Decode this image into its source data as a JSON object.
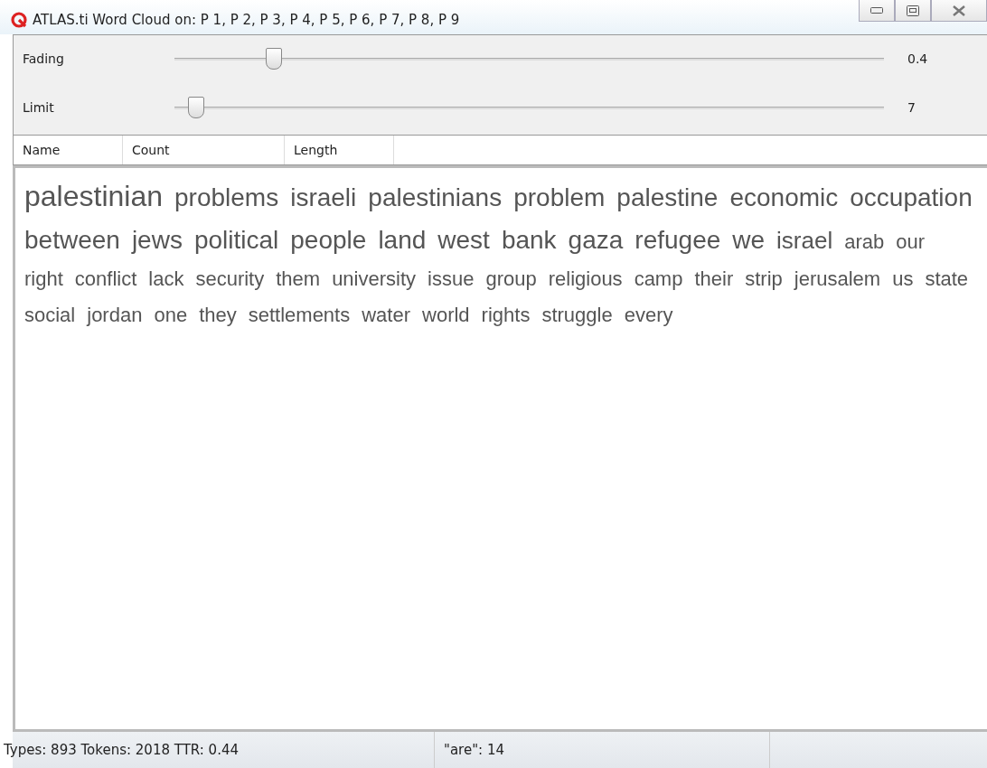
{
  "window": {
    "title": "ATLAS.ti Word Cloud on: P 1, P 2, P 3, P 4, P 5, P 6, P 7, P 8, P 9"
  },
  "sliders": [
    {
      "label": "Fading",
      "level": 0.14,
      "reading": "0.4"
    },
    {
      "label": "Limit",
      "level": 0.03,
      "reading": "7"
    }
  ],
  "table": {
    "columns": [
      "Name",
      "Count",
      "Length"
    ]
  },
  "words": [
    {
      "text": "palestinian",
      "kind": "xl"
    },
    {
      "text": "problems",
      "kind": "l"
    },
    {
      "text": "israeli",
      "kind": "l"
    },
    {
      "text": "palestinians",
      "kind": "l"
    },
    {
      "text": "problem",
      "kind": "l"
    },
    {
      "text": "palestine",
      "kind": "l"
    },
    {
      "text": "economic",
      "kind": "l"
    },
    {
      "text": "occupation",
      "kind": "l"
    },
    {
      "text": "between",
      "kind": "l"
    },
    {
      "text": "jews",
      "kind": "l"
    },
    {
      "text": "political",
      "kind": "l"
    },
    {
      "text": "people",
      "kind": "l"
    },
    {
      "text": "land",
      "kind": "l"
    },
    {
      "text": "west",
      "kind": "l"
    },
    {
      "text": "bank",
      "kind": "l"
    },
    {
      "text": "gaza",
      "kind": "l"
    },
    {
      "text": "refugee",
      "kind": "l"
    },
    {
      "text": "we",
      "kind": "l"
    },
    {
      "text": "israel",
      "kind": "m"
    },
    {
      "text": "arab",
      "kind": "s"
    },
    {
      "text": "our",
      "kind": "s"
    },
    {
      "text": "right",
      "kind": "s"
    },
    {
      "text": "conflict",
      "kind": "s"
    },
    {
      "text": "lack",
      "kind": "s"
    },
    {
      "text": "security",
      "kind": "s"
    },
    {
      "text": "them",
      "kind": "s"
    },
    {
      "text": "university",
      "kind": "s"
    },
    {
      "text": "issue",
      "kind": "s"
    },
    {
      "text": "group",
      "kind": "s"
    },
    {
      "text": "religious",
      "kind": "s"
    },
    {
      "text": "camp",
      "kind": "s"
    },
    {
      "text": "their",
      "kind": "s"
    },
    {
      "text": "strip",
      "kind": "s"
    },
    {
      "text": "jerusalem",
      "kind": "s"
    },
    {
      "text": "us",
      "kind": "s"
    },
    {
      "text": "state",
      "kind": "s"
    },
    {
      "text": "social",
      "kind": "s"
    },
    {
      "text": "jordan",
      "kind": "s"
    },
    {
      "text": "one",
      "kind": "s"
    },
    {
      "text": "they",
      "kind": "s"
    },
    {
      "text": "settlements",
      "kind": "s"
    },
    {
      "text": "water",
      "kind": "s"
    },
    {
      "text": "world",
      "kind": "s"
    },
    {
      "text": "rights",
      "kind": "s"
    },
    {
      "text": "struggle",
      "kind": "s"
    },
    {
      "text": "every",
      "kind": "s"
    }
  ],
  "status_bar": {
    "stats": "Types: 893 Tokens: 2018 TTR: 0.44",
    "selection": "\"are\": 14"
  }
}
